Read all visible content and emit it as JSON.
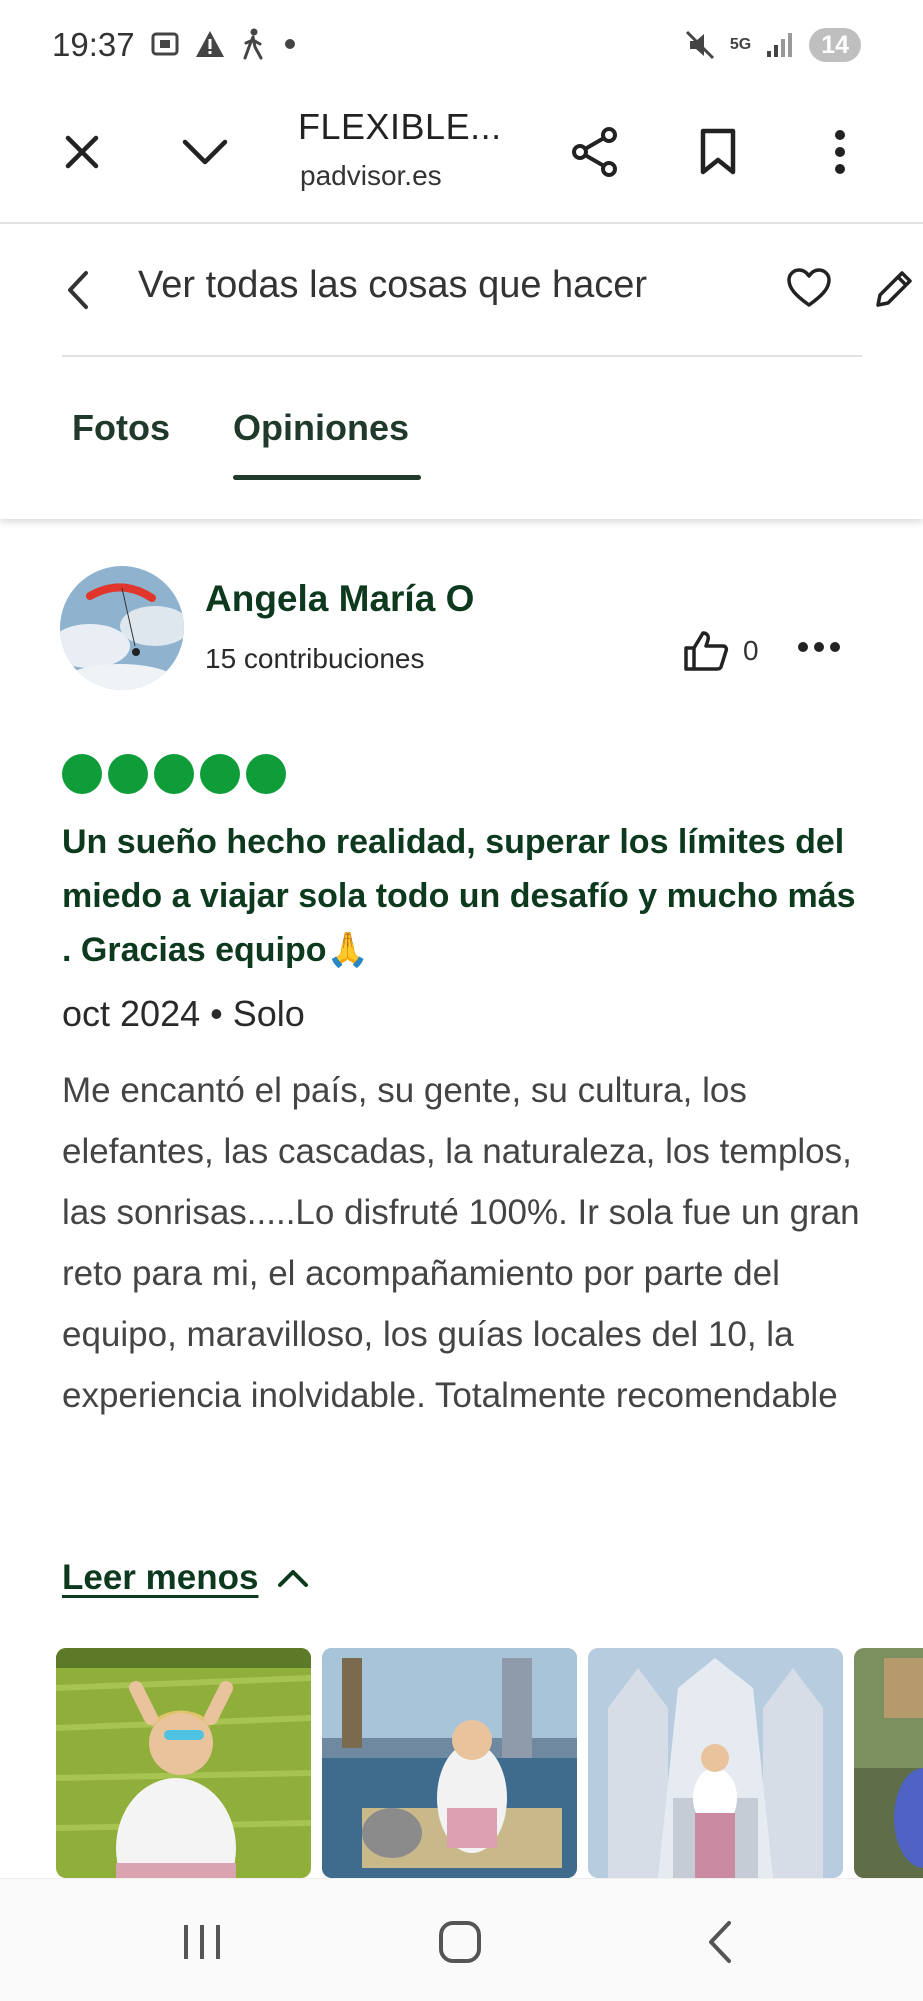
{
  "status_bar": {
    "time": "19:37",
    "network": "5G",
    "battery": "14",
    "icons": [
      "screenshot-icon",
      "warning-icon",
      "walking-icon",
      "dot-icon",
      "mute-icon",
      "signal-icon"
    ]
  },
  "browser": {
    "title": "FLEXIBLE...",
    "url": "padvisor.es"
  },
  "nav": {
    "back_label": "Ver todas las cosas que hacer"
  },
  "tabs": [
    {
      "label": "Fotos",
      "active": false
    },
    {
      "label": "Opiniones",
      "active": true
    }
  ],
  "review": {
    "author": "Angela María O",
    "contributions": "15 contribuciones",
    "likes": "0",
    "rating": 5,
    "title": "Un sueño hecho realidad, superar los límites del miedo a viajar sola todo un desafío y mucho más . Gracias equipo🙏",
    "meta": "oct 2024 • Solo",
    "body": "Me encantó el país, su gente, su cultura, los elefantes, las cascadas, la naturaleza, los templos, las sonrisas.....Lo disfruté 100%. Ir sola fue un gran reto para mi, el acompañamiento por parte del equipo, maravilloso, los guías locales del 10, la experiencia inolvidable. Totalmente recomendable",
    "read_less": "Leer menos"
  },
  "colors": {
    "rating_green": "#0f9d3a",
    "dark_green": "#0d3a1e"
  }
}
